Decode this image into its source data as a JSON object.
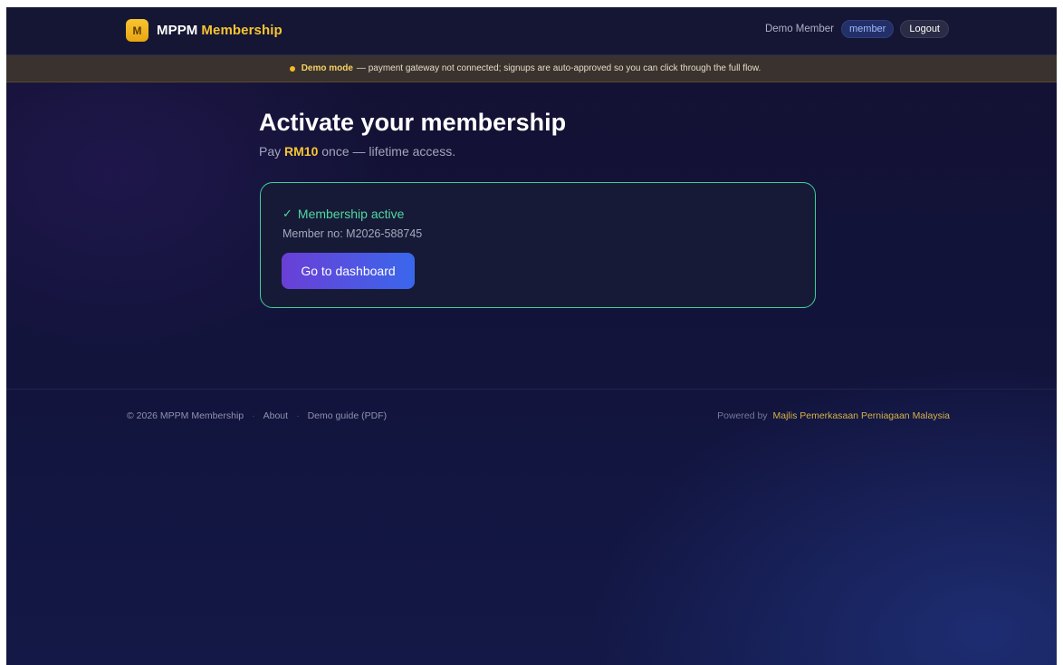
{
  "header": {
    "logo_letter": "M",
    "brand_primary": "MPPM",
    "brand_accent": "Membership",
    "user_name": "Demo Member",
    "role_badge": "member",
    "logout_label": "Logout"
  },
  "banner": {
    "strong": "Demo mode",
    "text": "— payment gateway not connected; signups are auto-approved so you can click through the full flow."
  },
  "main": {
    "title": "Activate your membership",
    "subtitle_prefix": "Pay",
    "price": "RM10",
    "subtitle_suffix": "once — lifetime access.",
    "card": {
      "check_glyph": "✓",
      "status": "Membership active",
      "member_no": "Member no: M2026-588745",
      "button_label": "Go to dashboard"
    }
  },
  "footer": {
    "copyright": "© 2026 MPPM Membership",
    "sep": "·",
    "links": [
      "About",
      "Demo guide (PDF)"
    ],
    "powered_by": "Powered by",
    "org": "Majlis Pemerkasaan Perniagaan Malaysia"
  },
  "colors": {
    "accent_gold": "#f7c531",
    "success_green": "#4fd8a4",
    "button_gradient_start": "#6a3fd6",
    "button_gradient_end": "#3a67ec"
  },
  "icons": {
    "status": "check-icon",
    "banner": "dot-icon"
  }
}
